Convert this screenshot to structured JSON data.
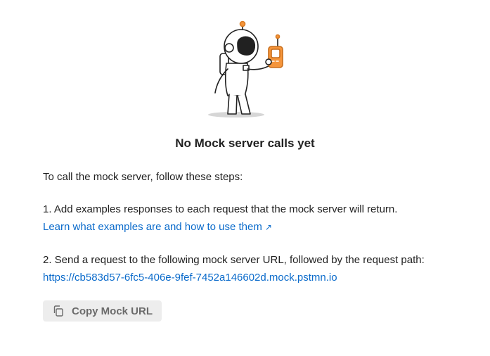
{
  "empty_state": {
    "title": "No Mock server calls yet",
    "intro": "To call the mock server, follow these steps:",
    "step1_text": "1. Add examples responses to each request that the mock server will return.",
    "step1_link": "Learn what examples are and how to use them",
    "step1_link_icon": "external-arrow-icon",
    "step2_text": "2. Send a request to the following mock server URL, followed by the request path:",
    "mock_url": "https://cb583d57-6fc5-406e-9fef-7452a146602d.mock.pstmn.io",
    "copy_button_label": "Copy Mock URL",
    "copy_button_icon": "copy-icon"
  },
  "colors": {
    "link": "#0b6bcb",
    "accent_orange": "#f5953b",
    "button_bg": "#ededed",
    "button_text": "#6b6b6b"
  }
}
